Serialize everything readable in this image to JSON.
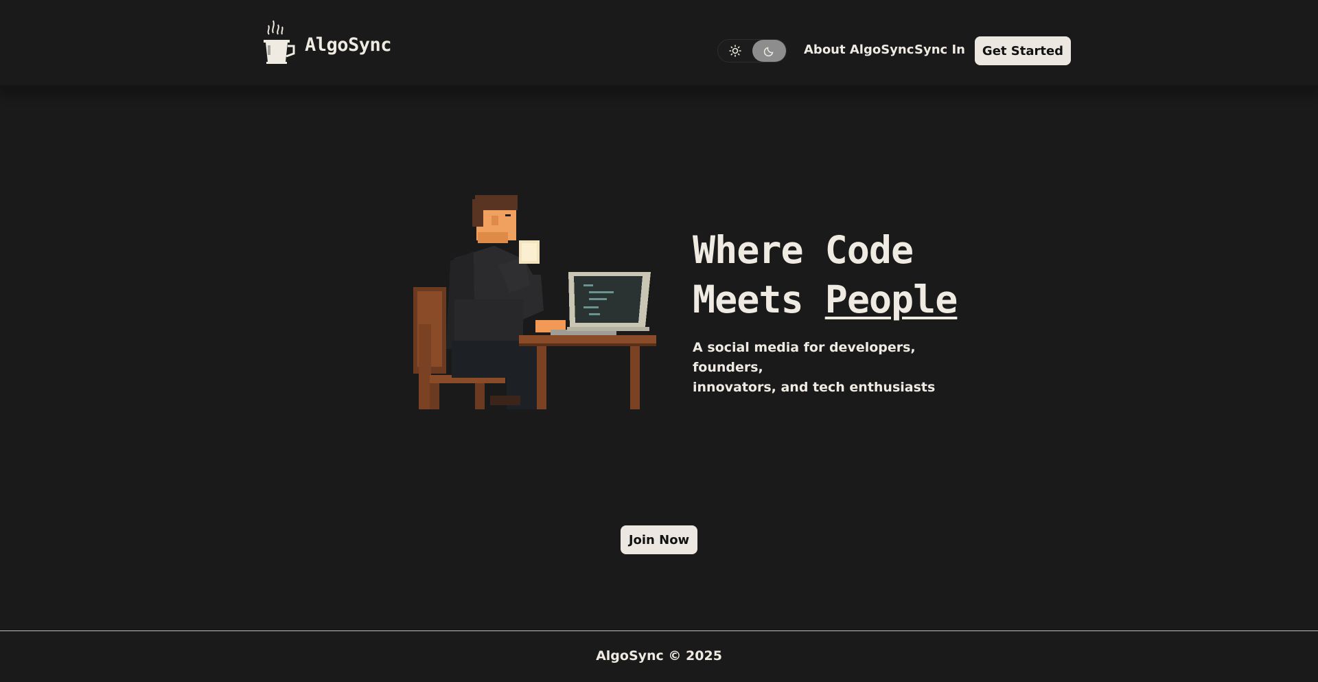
{
  "brand": {
    "name": "AlgoSync"
  },
  "theme": {
    "light_icon": "sun-icon",
    "dark_icon": "moon-icon",
    "selected": "dark"
  },
  "nav": {
    "links": [
      "About AlgoSync",
      "Sync In"
    ],
    "cta": "Get Started"
  },
  "hero": {
    "title_line1": "Where Code",
    "title_line2_plain": "Meets",
    "title_line2_underlined": "People",
    "subtitle_line1": "A social media for developers, founders,",
    "subtitle_line2": "innovators, and tech enthusiasts",
    "illustration": "pixel-art-developer-drinking-coffee-at-desk"
  },
  "join_button": "Join Now",
  "footer": {
    "text": "AlgoSync © 2025"
  },
  "colors": {
    "background": "#1a1a1a",
    "text": "#efebe3",
    "button_bg": "#ece8e1",
    "button_text": "#111111",
    "toggle_active": "#8d8d8d"
  }
}
